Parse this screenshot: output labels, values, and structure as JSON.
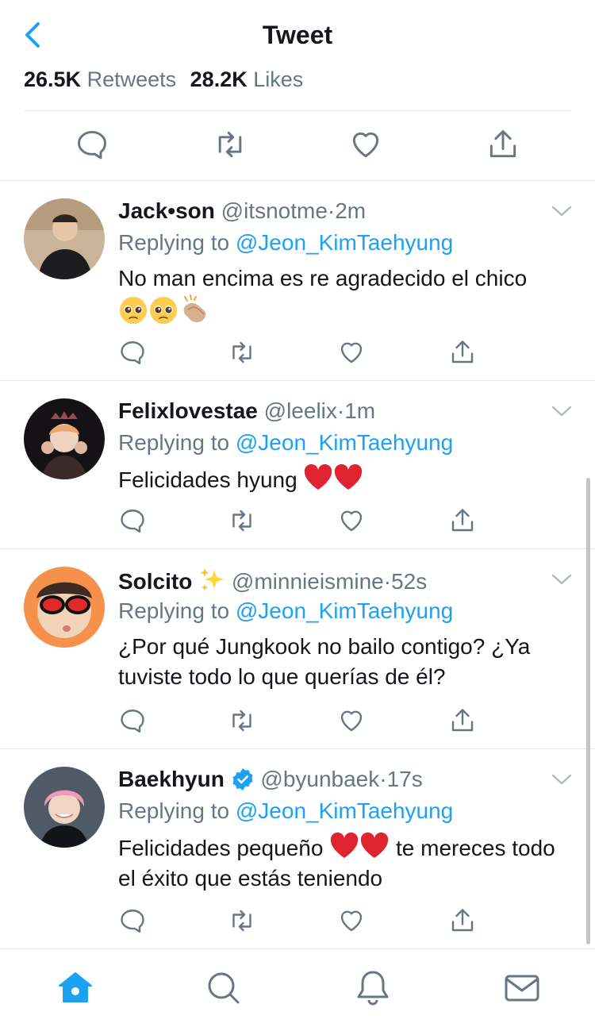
{
  "header": {
    "title": "Tweet"
  },
  "stats": {
    "retweets_count": "26.5K",
    "retweets_label": "Retweets",
    "likes_count": "28.2K",
    "likes_label": "Likes"
  },
  "replies": [
    {
      "name": "Jack•son",
      "handle": "@itsnotme",
      "time": "2m",
      "replying_prefix": "Replying to",
      "replying_to": "@Jeon_KimTaehyung",
      "text": "No man encima es re agradecido el chico",
      "emoji": [
        "pleading-face",
        "pleading-face",
        "clapping-hands"
      ]
    },
    {
      "name": "Felixlovestae",
      "handle": "@leelix",
      "time": "1m",
      "replying_prefix": "Replying to",
      "replying_to": "@Jeon_KimTaehyung",
      "text": "Felicidades hyung",
      "emoji": [
        "red-heart",
        "red-heart"
      ]
    },
    {
      "name": "Solcito",
      "name_emoji": "sparkles",
      "handle": "@minnieismine",
      "time": "52s",
      "replying_prefix": "Replying to",
      "replying_to": "@Jeon_KimTaehyung",
      "text": "¿Por qué Jungkook no bailo contigo? ¿Ya tuviste todo lo que querías de él?"
    },
    {
      "name": "Baekhyun",
      "verified": true,
      "handle": "@byunbaek",
      "time": "17s",
      "replying_prefix": "Replying to",
      "replying_to": "@Jeon_KimTaehyung",
      "text_before": "Felicidades pequeño",
      "text_after": "te mereces todo el éxito que estás teniendo",
      "emoji": [
        "red-heart",
        "red-heart"
      ]
    }
  ],
  "dot": "·",
  "colors": {
    "accent": "#1da1f2",
    "text": "#14171a",
    "muted": "#657786",
    "divider": "#e1e8ed",
    "heart_red": "#e0242f"
  },
  "tabbar": {
    "active": "home"
  }
}
